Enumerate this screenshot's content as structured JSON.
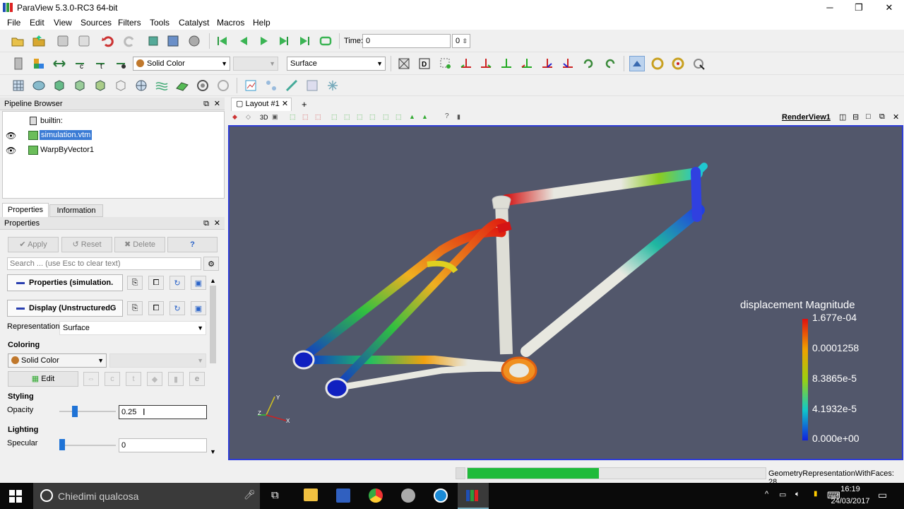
{
  "window": {
    "title": "ParaView 5.3.0-RC3 64-bit"
  },
  "menu": [
    "File",
    "Edit",
    "View",
    "Sources",
    "Filters",
    "Tools",
    "Catalyst",
    "Macros",
    "Help"
  ],
  "time": {
    "label": "Time:",
    "value": "0",
    "index": "0"
  },
  "toolbar": {
    "color_combo": "Solid Color",
    "repr_combo": "Surface"
  },
  "pipeline": {
    "header": "Pipeline Browser",
    "items": [
      "builtin:",
      "simulation.vtm",
      "WarpByVector1"
    ]
  },
  "tabs": {
    "properties": "Properties",
    "information": "Information"
  },
  "properties": {
    "header": "Properties",
    "apply": "Apply",
    "reset": "Reset",
    "delete": "Delete",
    "help": "?",
    "search_placeholder": "Search ... (use Esc to clear text)",
    "group1": "Properties (simulation.",
    "group2": "Display (UnstructuredG",
    "representation_label": "Representation",
    "representation_value": "Surface",
    "coloring_label": "Coloring",
    "coloring_value": "Solid Color",
    "edit": "Edit",
    "styling_label": "Styling",
    "opacity_label": "Opacity",
    "opacity_value": "0.25",
    "lighting_label": "Lighting",
    "specular_label": "Specular",
    "specular_value": "0"
  },
  "layout": {
    "tab": "Layout #1",
    "view_name": "RenderView1",
    "mode_3d": "3D"
  },
  "colorbar": {
    "title": "displacement Magnitude",
    "ticks": [
      "1.677e-04",
      "0.0001258",
      "8.3865e-5",
      "4.1932e-5",
      "0.000e+00"
    ],
    "colors": [
      "#e01010",
      "#f0a000",
      "#9ad010",
      "#10c8c8",
      "#1020e0"
    ]
  },
  "axes": {
    "y": "Y",
    "z": "Z",
    "x": "X"
  },
  "status": {
    "text": "GeometryRepresentationWithFaces: 28",
    "progress": 0.44
  },
  "taskbar": {
    "search": "Chiedimi qualcosa",
    "time": "16:19",
    "date": "24/03/2017"
  }
}
